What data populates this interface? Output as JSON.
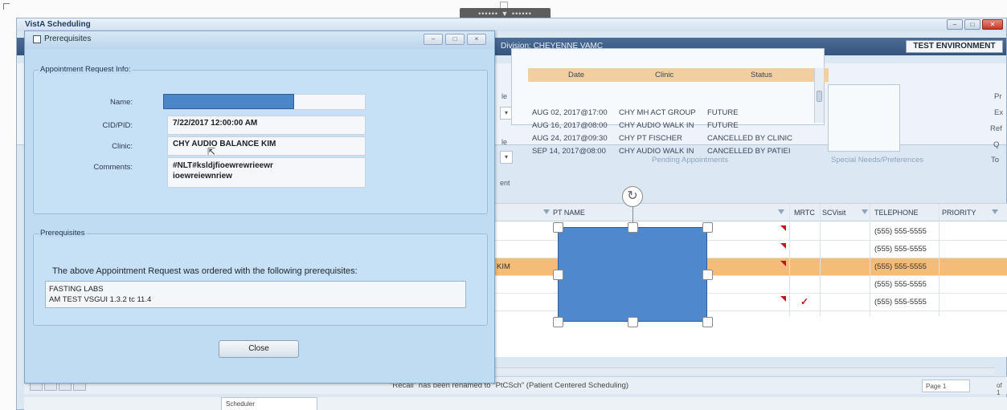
{
  "screen": {
    "top_dots": "•••••• ▼ ••••••"
  },
  "main_window": {
    "title": "VistA Scheduling",
    "division": "Division: CHEYENNE VAMC",
    "environment": "TEST ENVIRONMENT",
    "win_min": "–",
    "win_max": "□",
    "win_close": "✕"
  },
  "pending_appointments": {
    "caption": "Pending Appointments",
    "columns": [
      "Date",
      "Clinic",
      "Status"
    ],
    "rows": [
      {
        "date": "AUG 02, 2017@17:00",
        "clinic": "CHY MH ACT GROUP",
        "status": "FUTURE"
      },
      {
        "date": "AUG 16, 2017@08:00",
        "clinic": "CHY AUDIO WALK IN",
        "status": "FUTURE"
      },
      {
        "date": "AUG 24, 2017@09:30",
        "clinic": "CHY PT FISCHER",
        "status": "CANCELLED BY CLINIC"
      },
      {
        "date": "SEP 14, 2017@08:00",
        "clinic": "CHY AUDIO WALK IN",
        "status": "CANCELLED BY PATIEI"
      }
    ]
  },
  "special_needs": {
    "caption": "Special Needs/Preferences"
  },
  "ribbon_fragments": {
    "le1": "le",
    "le2": "le",
    "ent": "ent",
    "pr": "Pr",
    "ex": "Ex",
    "ref": "Ref",
    "q": "Q",
    "to": "To"
  },
  "grid": {
    "columns": [
      "PT NAME",
      "MRTC",
      "SCVisit",
      "TELEPHONE",
      "PRIORITY"
    ],
    "selected_fragment": "KIM",
    "rows": [
      {
        "telephone": "(555) 555-5555",
        "flag": true,
        "check": false
      },
      {
        "telephone": "(555) 555-5555",
        "flag": true,
        "check": false
      },
      {
        "telephone": "(555) 555-5555",
        "flag": true,
        "check": false
      },
      {
        "telephone": "(555) 555-5555",
        "flag": false,
        "check": false
      },
      {
        "telephone": "(555) 555-5555",
        "flag": true,
        "check": true
      }
    ],
    "check_mark": "✓"
  },
  "status_bar": {
    "message": "\"Recall\" has been renamed to \"PtCSch\" (Patient Centered Scheduling)",
    "page_label": "Page",
    "page_value": "1",
    "of_label": "of 1"
  },
  "bottom_tab": {
    "label": "Scheduler"
  },
  "dialog": {
    "title": "Prerequisites",
    "btn_min": "–",
    "btn_max": "□",
    "btn_close": "×",
    "request_group_label": "Appointment Request Info:",
    "fields": {
      "name_label": "Name:",
      "cid_label": "CID/PID:",
      "cid_value": "7/22/2017 12:00:00 AM",
      "clinic_label": "Clinic:",
      "clinic_value": "CHY AUDIO BALANCE KIM",
      "comments_label": "Comments:",
      "comments_line1": "#NLT#ksldjfioewrewrieewr",
      "comments_line2": "ioewreiewnriew"
    },
    "prereq_group_label": "Prerequisites",
    "prereq_text": "The above Appointment Request was ordered with the following prerequisites:",
    "prereq_items": [
      "FASTING LABS",
      "AM TEST VSGUI 1.3.2 tc 11.4"
    ],
    "close_label": "Close"
  },
  "overlay": {
    "rotate_glyph": "↻"
  }
}
